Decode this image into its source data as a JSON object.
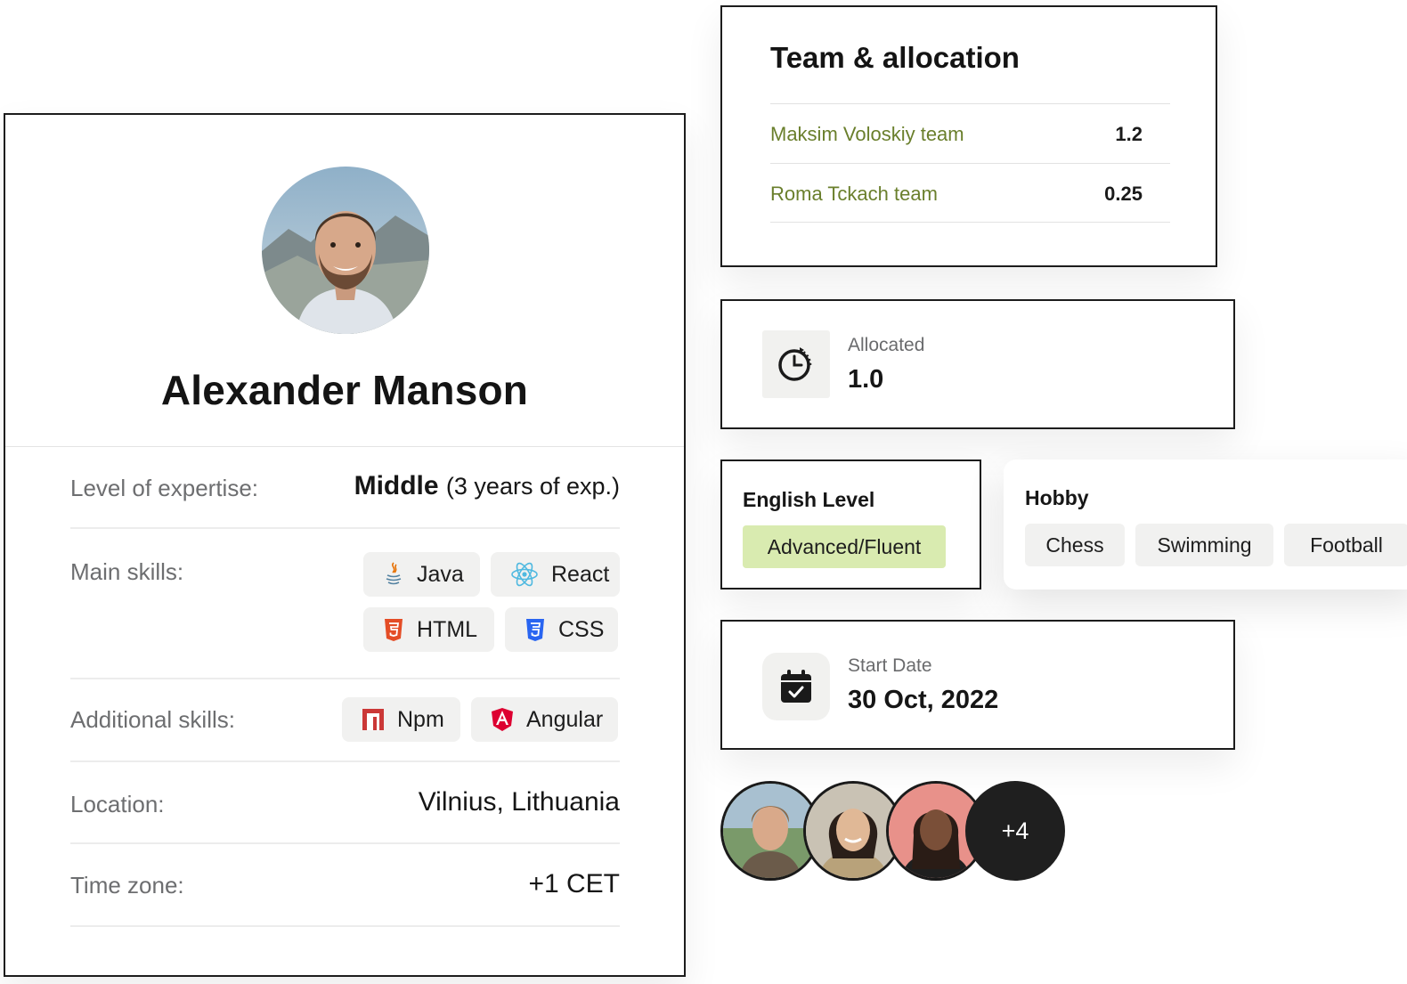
{
  "profile": {
    "name": "Alexander Manson",
    "rows": {
      "expertise": {
        "label": "Level of expertise:",
        "level": "Middle",
        "detail": "(3 years of exp.)"
      },
      "main_skills": {
        "label": "Main skills:",
        "skills": [
          {
            "name": "Java",
            "icon": "java-icon"
          },
          {
            "name": "React",
            "icon": "react-icon"
          },
          {
            "name": "HTML",
            "icon": "html5-icon"
          },
          {
            "name": "CSS",
            "icon": "css3-icon"
          }
        ]
      },
      "additional_skills": {
        "label": "Additional skills:",
        "skills": [
          {
            "name": "Npm",
            "icon": "npm-icon"
          },
          {
            "name": "Angular",
            "icon": "angular-icon"
          }
        ]
      },
      "location": {
        "label": "Location:",
        "value": "Vilnius, Lithuania"
      },
      "timezone": {
        "label": "Time zone:",
        "value": "+1 CET"
      }
    }
  },
  "team": {
    "title": "Team & allocation",
    "teams": [
      {
        "name": "Maksim Voloskiy team",
        "value": "1.2"
      },
      {
        "name": "Roma Tckach team",
        "value": "0.25"
      }
    ]
  },
  "allocated": {
    "label": "Allocated",
    "value": "1.0",
    "icon": "timer-icon"
  },
  "english": {
    "title": "English Level",
    "level": "Advanced/Fluent"
  },
  "hobby": {
    "title": "Hobby",
    "items": [
      "Chess",
      "Swimming",
      "Football"
    ]
  },
  "start_date": {
    "label": "Start Date",
    "value": "30 Oct, 2022",
    "icon": "calendar-check-icon"
  },
  "members": {
    "more": "+4"
  },
  "colors": {
    "team_link": "#6a7f2c",
    "english_badge": "#d9ebb0",
    "chip_bg": "#f1f1f0",
    "border": "#1c1c1c"
  }
}
